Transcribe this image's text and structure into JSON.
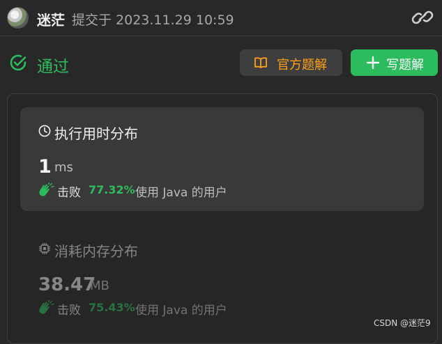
{
  "header": {
    "username": "迷茫",
    "submitted_label": "提交于 2023.11.29 10:59"
  },
  "status": {
    "label": "通过",
    "color": "#2cbb5d"
  },
  "buttons": {
    "official_solution": "官方题解",
    "write_solution": "写题解"
  },
  "runtime": {
    "title": "执行用时分布",
    "value": "1",
    "unit": "ms",
    "beats_word": "击败",
    "beats_percent": "77.32%",
    "beats_tail": "使用 Java 的用户"
  },
  "memory": {
    "title": "消耗内存分布",
    "value": "38.47",
    "unit": "MB",
    "beats_word": "击败",
    "beats_percent": "75.43%",
    "beats_tail": "使用 Java 的用户"
  },
  "watermark": "CSDN @迷茫9",
  "colors": {
    "accent_green": "#2cbb5d",
    "accent_orange": "#ffa116",
    "background": "#282828"
  },
  "icons": [
    "avatar",
    "link-icon",
    "check-circle-icon",
    "book-icon",
    "plus-icon",
    "clock-icon",
    "clapping-hands-icon",
    "chip-icon"
  ]
}
